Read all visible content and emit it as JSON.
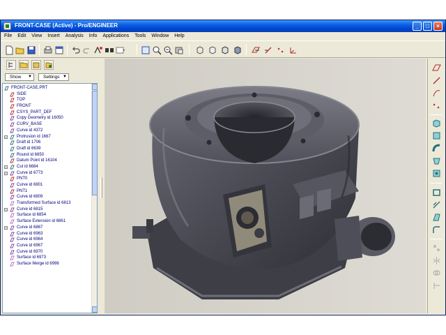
{
  "window": {
    "title": "FRONT-CASE (Active) - Pro/ENGINEER"
  },
  "menubar": {
    "items": [
      "File",
      "Edit",
      "View",
      "Insert",
      "Analysis",
      "Info",
      "Applications",
      "Tools",
      "Window",
      "Help"
    ]
  },
  "left_panel": {
    "show_label": "Show",
    "settings_label": "Settings"
  },
  "tree": {
    "items": [
      {
        "label": "FRONT-CASE.PRT",
        "icon": "part-icon",
        "expander": false
      },
      {
        "label": "SIDE",
        "icon": "datum-plane-icon",
        "expander": false
      },
      {
        "label": "TOP",
        "icon": "datum-plane-icon",
        "expander": false
      },
      {
        "label": "FRONT",
        "icon": "datum-plane-icon",
        "expander": false
      },
      {
        "label": "CSYS_PART_DEF",
        "icon": "csys-icon",
        "expander": false
      },
      {
        "label": "Copy Geometry id 16050",
        "icon": "copy-geometry-icon",
        "expander": false
      },
      {
        "label": "CURV_BASE",
        "icon": "curve-icon",
        "expander": false
      },
      {
        "label": "Curve id 4372",
        "icon": "curve-icon",
        "expander": false
      },
      {
        "label": "Protrusion id 1667",
        "icon": "protrusion-icon",
        "expander": true
      },
      {
        "label": "Draft id 1706",
        "icon": "draft-icon",
        "expander": false
      },
      {
        "label": "Draft id 6639",
        "icon": "draft-icon",
        "expander": false
      },
      {
        "label": "Round id 6650",
        "icon": "round-icon",
        "expander": false
      },
      {
        "label": "Datum Point id 16104",
        "icon": "datum-point-icon",
        "expander": false
      },
      {
        "label": "Cut id 6684",
        "icon": "cut-icon",
        "expander": true
      },
      {
        "label": "Curve id 6773",
        "icon": "curve-icon",
        "expander": true
      },
      {
        "label": "PNT0",
        "icon": "datum-point-icon",
        "expander": false
      },
      {
        "label": "Curve id 6801",
        "icon": "curve-icon",
        "expander": false
      },
      {
        "label": "PNT1",
        "icon": "datum-point-icon",
        "expander": false
      },
      {
        "label": "Curve id 6809",
        "icon": "curve-icon",
        "expander": false
      },
      {
        "label": "Transformed Surface id 6813",
        "icon": "surface-icon",
        "expander": false
      },
      {
        "label": "Curve id 6815",
        "icon": "curve-icon",
        "expander": true
      },
      {
        "label": "Surface id 6854",
        "icon": "surface-icon",
        "expander": false
      },
      {
        "label": "Surface Extension id 6861",
        "icon": "surface-icon",
        "expander": false
      },
      {
        "label": "Curve id 6867",
        "icon": "curve-icon",
        "expander": true
      },
      {
        "label": "Curve id 6963",
        "icon": "curve-icon",
        "expander": false
      },
      {
        "label": "Curve id 6964",
        "icon": "curve-icon",
        "expander": false
      },
      {
        "label": "Curve id 6967",
        "icon": "curve-icon",
        "expander": false
      },
      {
        "label": "Curve id 6970",
        "icon": "curve-icon",
        "expander": false
      },
      {
        "label": "Surface id 6973",
        "icon": "surface-icon",
        "expander": false
      },
      {
        "label": "Surface Merge id 6998",
        "icon": "merge-icon",
        "expander": false
      }
    ]
  },
  "colors": {
    "titlebar": "#0046d5",
    "chrome": "#ece9d8",
    "viewport_bg": "#d4d0c8",
    "model_body": "#4a4b54",
    "tree_text": "#00007a"
  }
}
